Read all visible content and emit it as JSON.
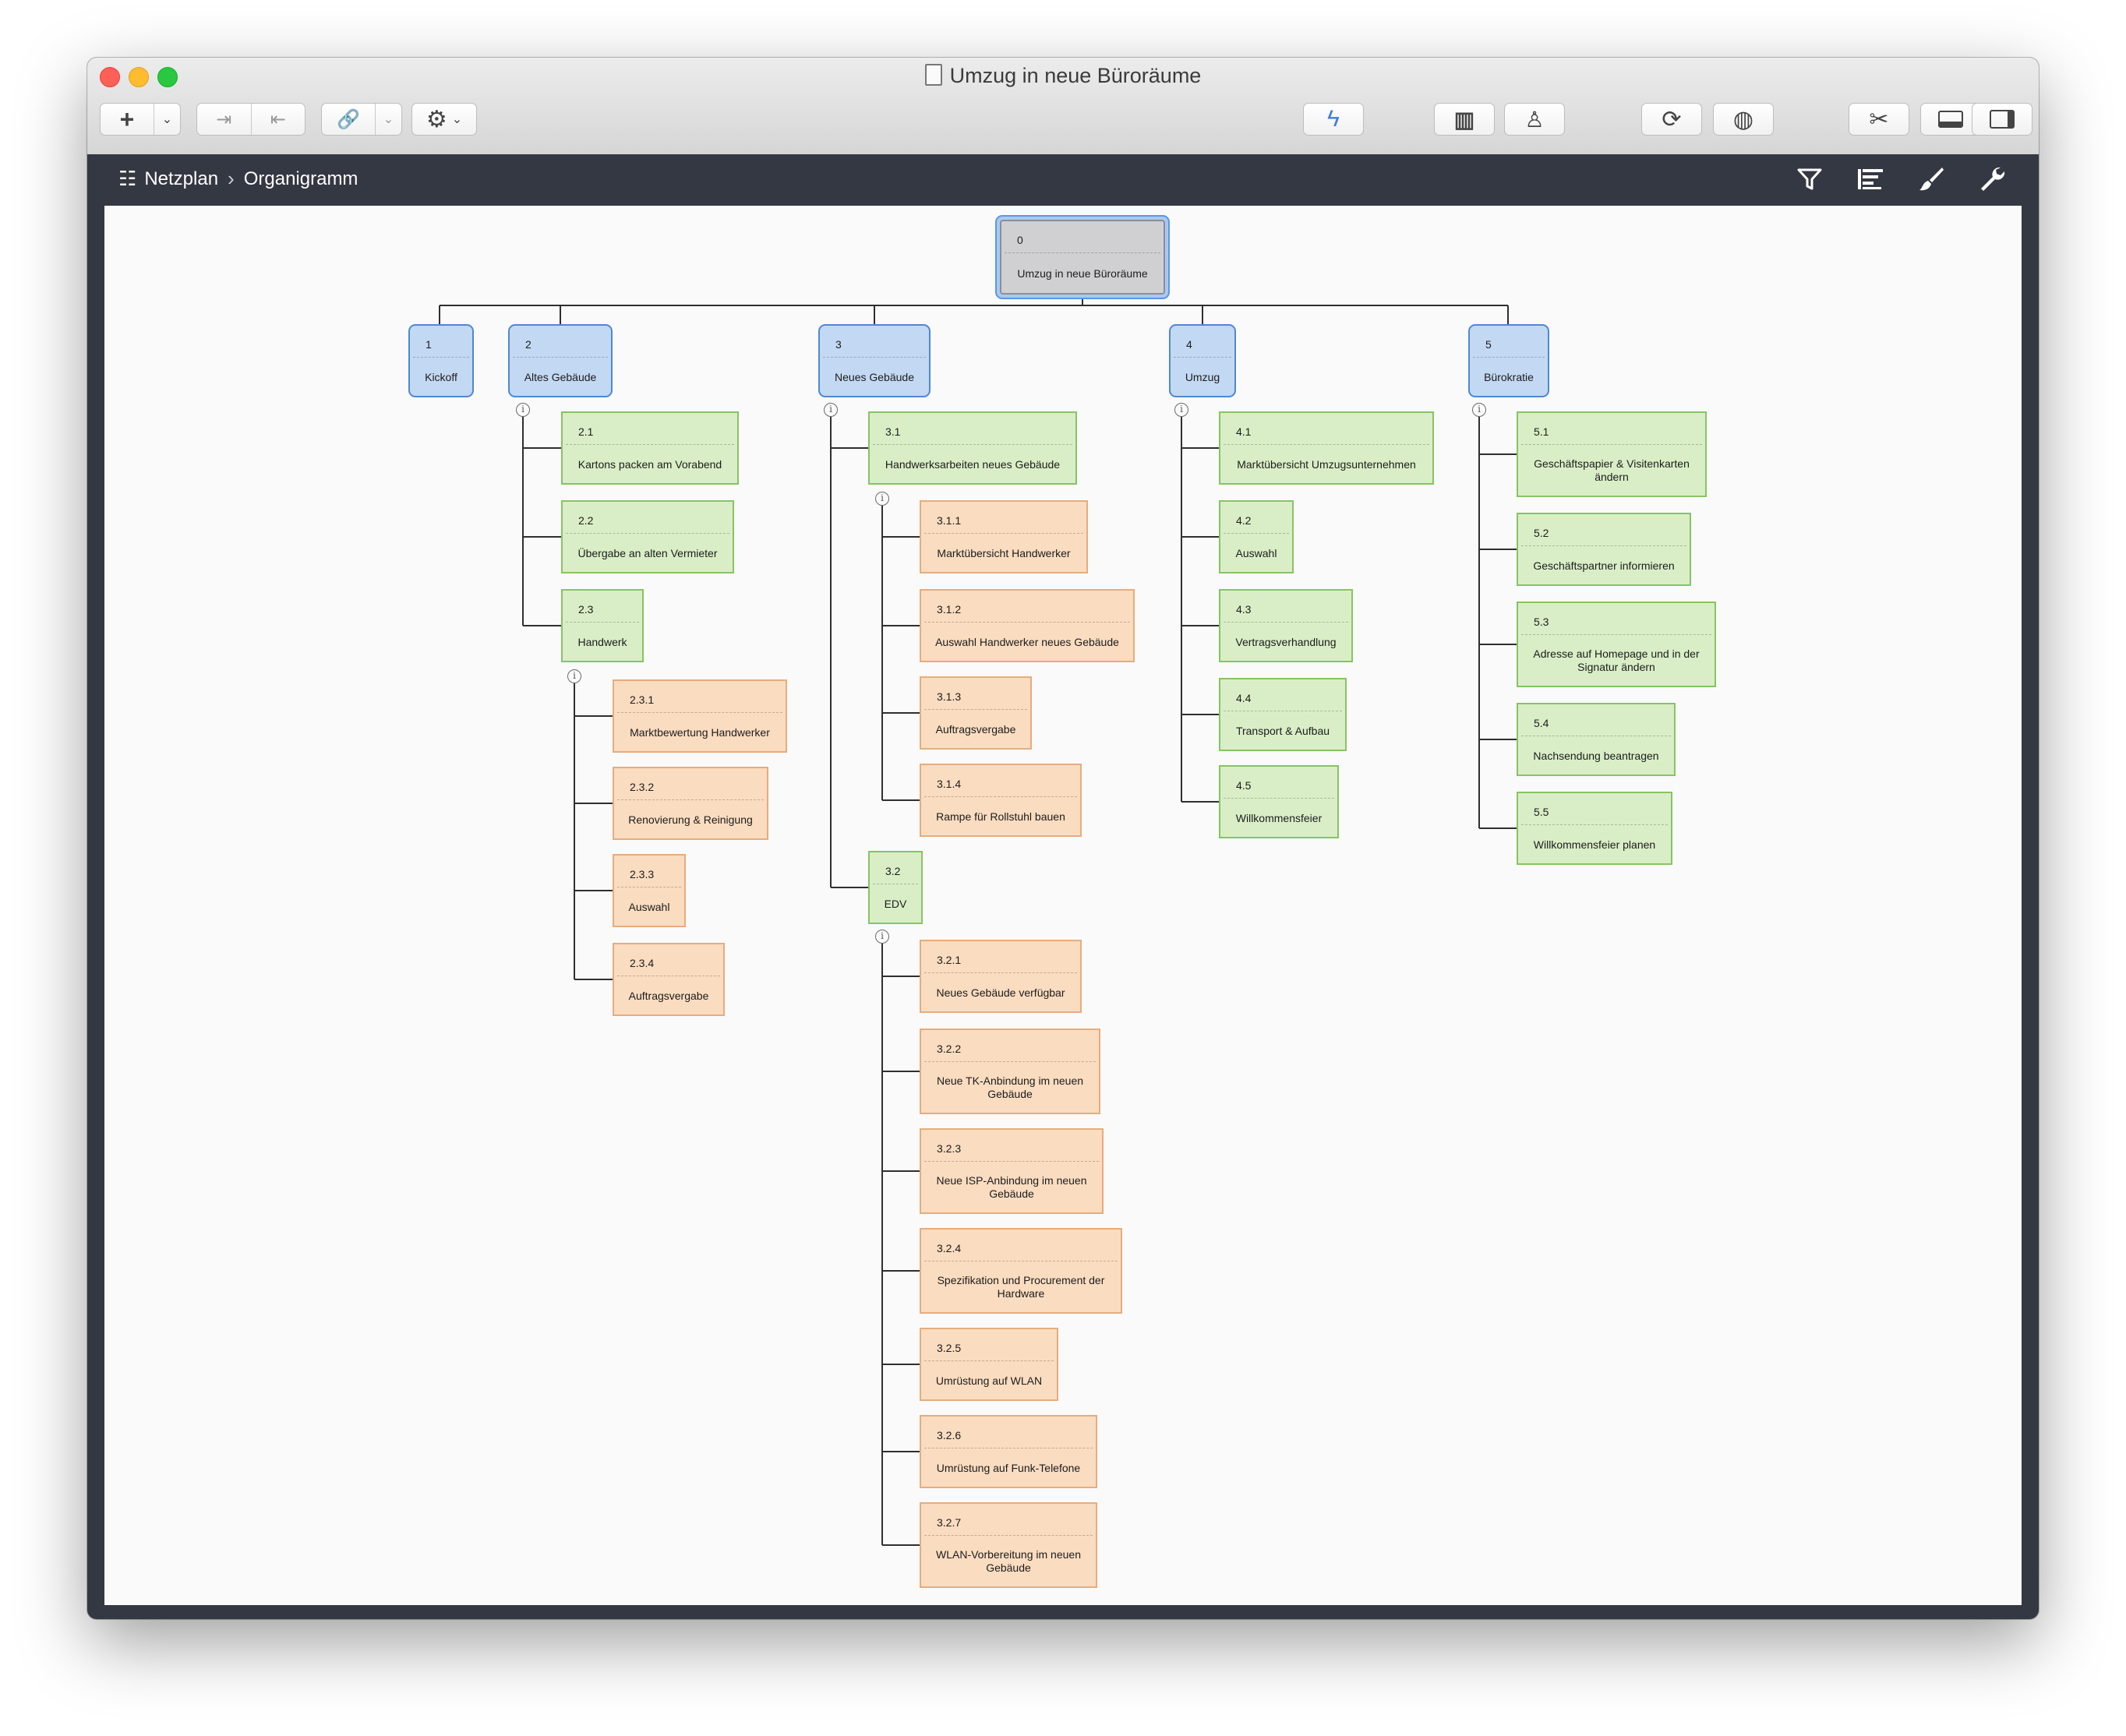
{
  "window": {
    "title": "Umzug in neue Büroräume"
  },
  "toolbar": {
    "add_icon": "plus-icon",
    "indent_icon": "indent-icon",
    "outdent_icon": "outdent-icon",
    "link_icon": "link-icon",
    "settings_icon": "gear-icon",
    "quick_entry_icon": "lightning-icon",
    "library_icon": "library-icon",
    "resources_icon": "person-icon",
    "sync_icon": "sync-icon",
    "publish_icon": "publish-icon",
    "tools_icon": "tools-icon",
    "bottom_pane_icon": "bottom-pane-icon",
    "side_pane_icon": "side-pane-icon",
    "accent_color": "#3f7be0"
  },
  "pathbar": {
    "crumbs": [
      "Netzplan",
      "Organigramm"
    ],
    "icons": [
      "filter-icon",
      "outline-icon",
      "brush-icon",
      "wrench-icon"
    ]
  },
  "diagram": {
    "colors": {
      "root": "#d0d0d3",
      "level1": "#c3d8f3",
      "work_package": "#d9eec6",
      "sub_task": "#fadcc0"
    },
    "root": {
      "num": "0",
      "label": "Umzug in neue Büroräume"
    },
    "level1": [
      {
        "num": "1",
        "label": "Kickoff"
      },
      {
        "num": "2",
        "label": "Altes Gebäude"
      },
      {
        "num": "3",
        "label": "Neues Gebäude"
      },
      {
        "num": "4",
        "label": "Umzug"
      },
      {
        "num": "5",
        "label": "Bürokratie"
      }
    ],
    "n2": [
      {
        "num": "2.1",
        "label": "Kartons packen am Vorabend"
      },
      {
        "num": "2.2",
        "label": "Übergabe an alten Vermieter"
      },
      {
        "num": "2.3",
        "label": "Handwerk"
      }
    ],
    "n23": [
      {
        "num": "2.3.1",
        "label": "Marktbewertung Handwerker"
      },
      {
        "num": "2.3.2",
        "label": "Renovierung & Reinigung"
      },
      {
        "num": "2.3.3",
        "label": "Auswahl"
      },
      {
        "num": "2.3.4",
        "label": "Auftragsvergabe"
      }
    ],
    "n3": [
      {
        "num": "3.1",
        "label": "Handwerksarbeiten neues Gebäude"
      },
      {
        "num": "3.2",
        "label": "EDV"
      }
    ],
    "n31": [
      {
        "num": "3.1.1",
        "label": "Marktübersicht Handwerker"
      },
      {
        "num": "3.1.2",
        "label": "Auswahl Handwerker neues Gebäude"
      },
      {
        "num": "3.1.3",
        "label": "Auftragsvergabe"
      },
      {
        "num": "3.1.4",
        "label": "Rampe für Rollstuhl bauen"
      }
    ],
    "n32": [
      {
        "num": "3.2.1",
        "label": "Neues Gebäude verfügbar"
      },
      {
        "num": "3.2.2",
        "label": "Neue TK-Anbindung im neuen Gebäude"
      },
      {
        "num": "3.2.3",
        "label": "Neue ISP-Anbindung im neuen Gebäude"
      },
      {
        "num": "3.2.4",
        "label": "Spezifikation und Procurement der Hardware"
      },
      {
        "num": "3.2.5",
        "label": "Umrüstung auf WLAN"
      },
      {
        "num": "3.2.6",
        "label": "Umrüstung auf Funk-Telefone"
      },
      {
        "num": "3.2.7",
        "label": "WLAN-Vorbereitung im neuen Gebäude"
      }
    ],
    "n4": [
      {
        "num": "4.1",
        "label": "Marktübersicht Umzugsunternehmen"
      },
      {
        "num": "4.2",
        "label": "Auswahl"
      },
      {
        "num": "4.3",
        "label": "Vertragsverhandlung"
      },
      {
        "num": "4.4",
        "label": "Transport & Aufbau"
      },
      {
        "num": "4.5",
        "label": "Willkommensfeier"
      }
    ],
    "n5": [
      {
        "num": "5.1",
        "label": "Geschäftspapier & Visitenkarten ändern"
      },
      {
        "num": "5.2",
        "label": "Geschäftspartner informieren"
      },
      {
        "num": "5.3",
        "label": "Adresse auf Homepage und in der Signatur ändern"
      },
      {
        "num": "5.4",
        "label": "Nachsendung beantragen"
      },
      {
        "num": "5.5",
        "label": "Willkommensfeier planen"
      }
    ]
  }
}
